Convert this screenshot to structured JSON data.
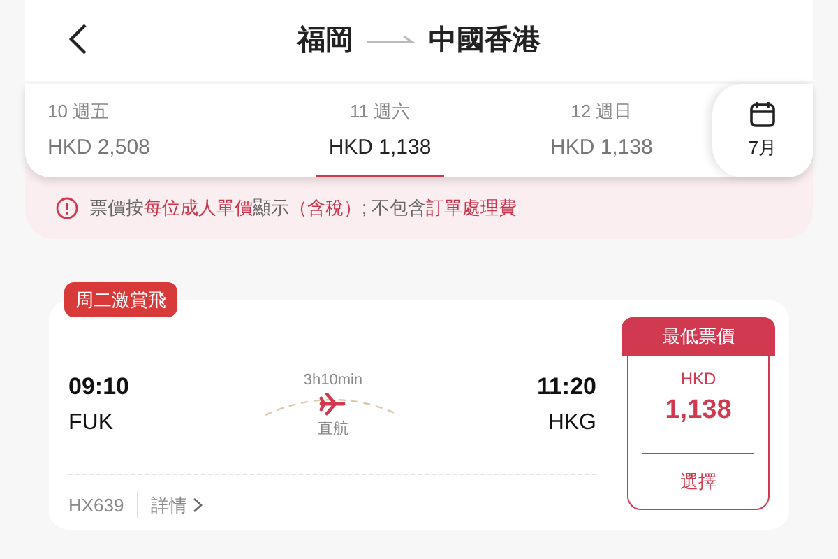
{
  "header": {
    "origin": "福岡",
    "destination": "中國香港"
  },
  "dates": [
    {
      "day": "10 週五",
      "price": "HKD 2,508",
      "selected": false
    },
    {
      "day": "11 週六",
      "price": "HKD 1,138",
      "selected": true
    },
    {
      "day": "12 週日",
      "price": "HKD 1,138",
      "selected": false
    }
  ],
  "calendar": {
    "month": "7月"
  },
  "notice": [
    {
      "text": "票價按",
      "highlight": false
    },
    {
      "text": "每位成人單價",
      "highlight": true
    },
    {
      "text": "顯示",
      "highlight": false
    },
    {
      "text": "（含稅）",
      "highlight": true
    },
    {
      "text": "; 不包含",
      "highlight": false
    },
    {
      "text": "訂單處理費",
      "highlight": true
    }
  ],
  "flight": {
    "badge": "周二激賞飛",
    "depart_time": "09:10",
    "depart_airport": "FUK",
    "duration": "3h10min",
    "stops": "直航",
    "arrive_time": "11:20",
    "arrive_airport": "HKG",
    "flight_number": "HX639",
    "details": "詳情",
    "price_tag": "最低票價",
    "currency": "HKD",
    "price": "1,138",
    "select": "選擇"
  }
}
